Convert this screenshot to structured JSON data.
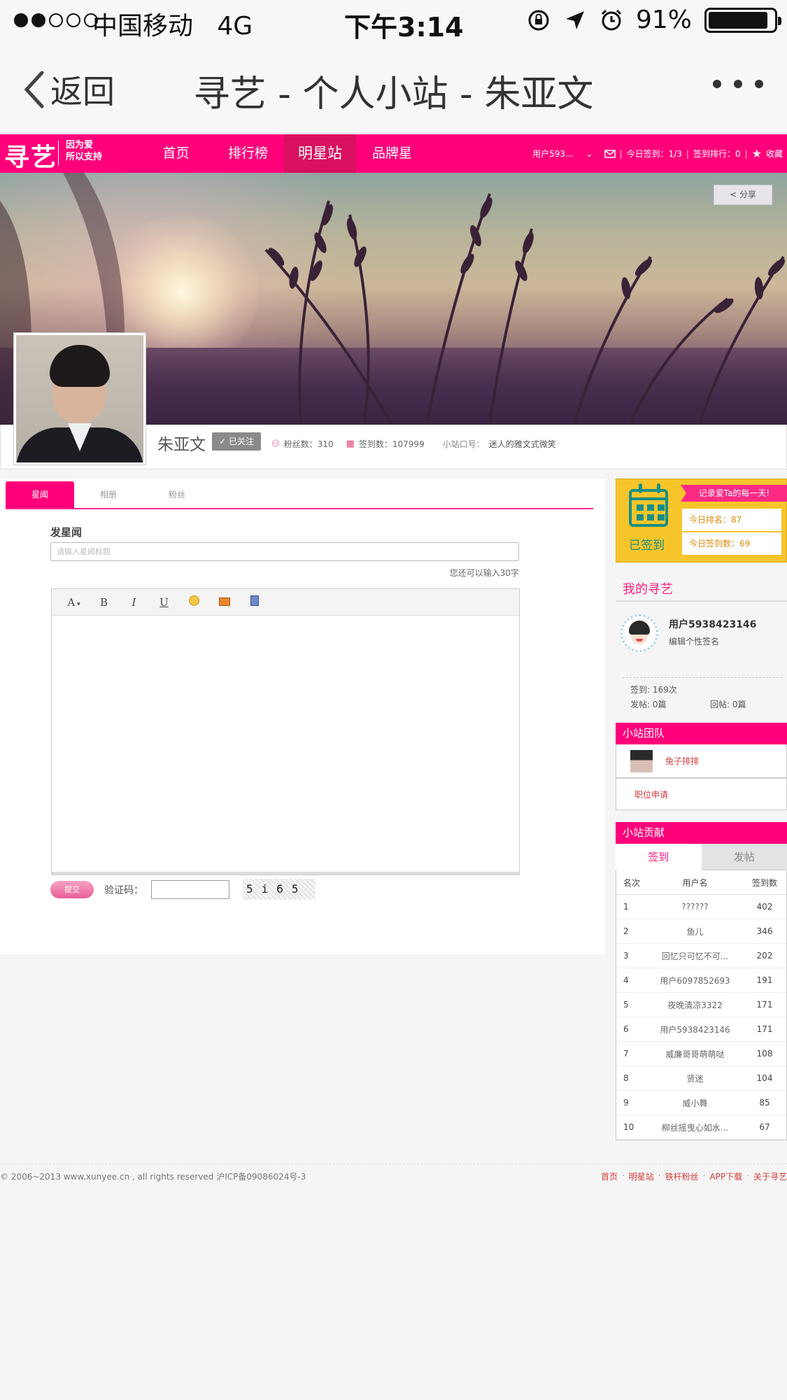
{
  "status_bar": {
    "carrier": "中国移动",
    "network": "4G",
    "time": "下午3:14",
    "battery": "91%",
    "battery_level": 0.91
  },
  "nav": {
    "back_label": "返回",
    "title": "寻艺 - 个人小站 - 朱亚文"
  },
  "site_header": {
    "logo": "寻艺",
    "slogan_line1": "因为爱",
    "slogan_line2": "所以支持",
    "menu": [
      "首页",
      "排行榜",
      "明星站",
      "品牌星"
    ],
    "active_menu": "明星站",
    "user": "用户593...",
    "today_checkin": "今日签到：1/3",
    "checkin_rank": "签到排行：0",
    "favorite": "收藏"
  },
  "banner": {
    "share_label": "分享"
  },
  "profile": {
    "name": "朱亚文",
    "follow_status": "已关注",
    "fans_label": "粉丝数：",
    "fans": "310",
    "checkins_label": "签到数：",
    "checkins": "107999",
    "slogan_label": "小站口号：",
    "slogan": "迷人的雅文式微笑"
  },
  "tabs": [
    "星闻",
    "相册",
    "粉丝"
  ],
  "post_form": {
    "label": "发星闻",
    "title_placeholder": "请输入星闻标题",
    "char_hint": "您还可以输入30字",
    "toolbar": {
      "font": "A",
      "bold": "B",
      "italic": "I",
      "underline": "U"
    },
    "submit_label": "提交",
    "captcha_label": "验证码：",
    "captcha_text": "5i65"
  },
  "checkin_card": {
    "status": "已签到",
    "ribbon": "记录爱Ta的每一天!",
    "today_rank": "今日排名：87",
    "today_count": "今日签到数：69"
  },
  "my_xunyi": {
    "title": "我的寻艺",
    "username": "用户5938423146",
    "edit_signature": "编辑个性签名",
    "checkins": "签到: 169次",
    "posts": "发帖: 0篇",
    "replies": "回帖: 0篇"
  },
  "team": {
    "title": "小站团队",
    "member": "兔子排排",
    "apply": "职位申请"
  },
  "contribution": {
    "title": "小站贡献",
    "tabs": [
      "签到",
      "发帖"
    ],
    "headers": [
      "名次",
      "用户名",
      "签到数"
    ],
    "rows": [
      [
        "1",
        "??????",
        "402"
      ],
      [
        "2",
        "鱼儿",
        "346"
      ],
      [
        "3",
        "回忆只可忆不可...",
        "202"
      ],
      [
        "4",
        "用户6097852693",
        "191"
      ],
      [
        "5",
        "夜晚清凉3322",
        "171"
      ],
      [
        "6",
        "用户5938423146",
        "171"
      ],
      [
        "7",
        "威廉哥哥萌萌哒",
        "108"
      ],
      [
        "8",
        "贤迷",
        "104"
      ],
      [
        "9",
        "威小舞",
        "85"
      ],
      [
        "10",
        "柳丝摇曳心如水...",
        "67"
      ]
    ]
  },
  "footer": {
    "copyright": "© 2006~2013 www.xunyee.cn , all rights reserved 沪ICP备09086024号-3",
    "links": [
      "首页",
      "明星站",
      "铁杆粉丝",
      "APP下载",
      "关于寻艺"
    ]
  },
  "colors": {
    "brand": "#ff007a",
    "accent_teal": "#188f86",
    "checkin_yellow": "#f7c52a"
  }
}
